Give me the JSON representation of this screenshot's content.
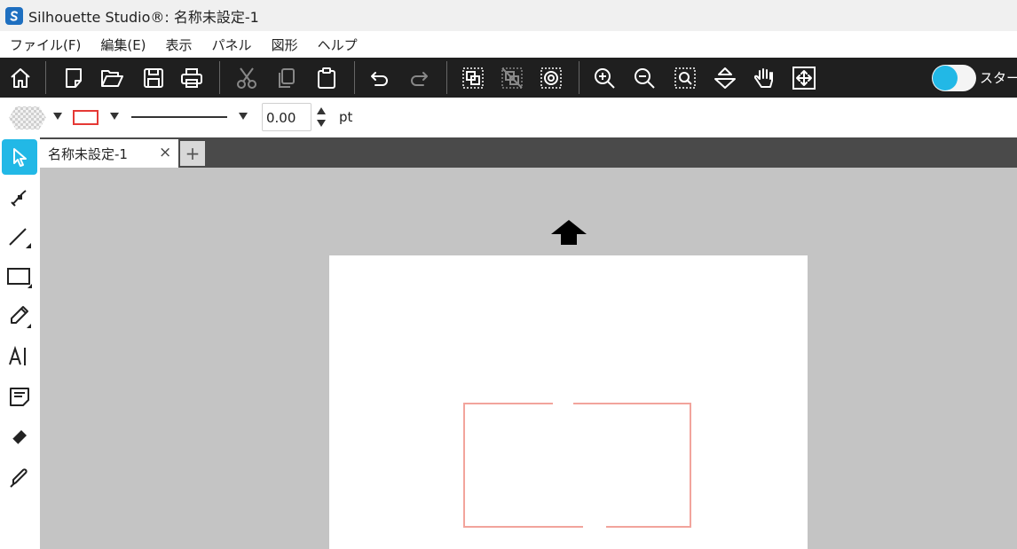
{
  "window": {
    "title": "Silhouette Studio®: 名称未設定-1"
  },
  "menu": {
    "items": [
      {
        "label": "ファイル(F)"
      },
      {
        "label": "編集(E)"
      },
      {
        "label": "表示"
      },
      {
        "label": "パネル"
      },
      {
        "label": "図形"
      },
      {
        "label": "ヘルプ"
      }
    ]
  },
  "toolbar": {
    "toggle_label": "スター"
  },
  "properties": {
    "line_width_value": "0.00",
    "line_width_unit": "pt",
    "line_color": "#e53935"
  },
  "tabs": [
    {
      "label": "名称未設定-1"
    }
  ],
  "tab_close": "×",
  "tab_add": "+",
  "colors": {
    "accent": "#22b8e6",
    "toolbar_bg": "#1f1f1f",
    "canvas_bg": "#c4c4c4",
    "shape_stroke": "#f2a49c"
  }
}
